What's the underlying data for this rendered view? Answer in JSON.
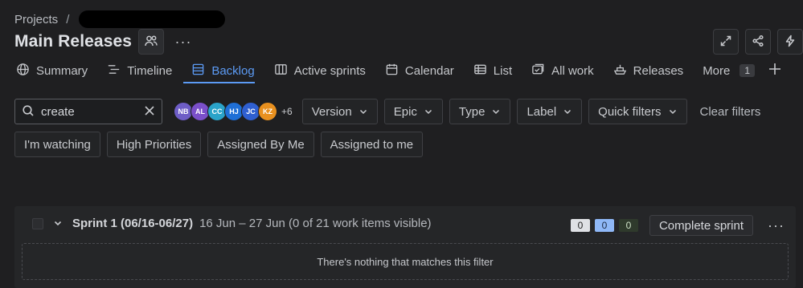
{
  "breadcrumb": {
    "root": "Projects",
    "separator": "/"
  },
  "header": {
    "title": "Main Releases",
    "more": "···"
  },
  "tabs": [
    {
      "label": "Summary",
      "icon": "globe-icon"
    },
    {
      "label": "Timeline",
      "icon": "timeline-icon"
    },
    {
      "label": "Backlog",
      "icon": "backlog-icon",
      "active": true
    },
    {
      "label": "Active sprints",
      "icon": "board-icon"
    },
    {
      "label": "Calendar",
      "icon": "calendar-icon"
    },
    {
      "label": "List",
      "icon": "list-icon"
    },
    {
      "label": "All work",
      "icon": "all-work-icon"
    },
    {
      "label": "Releases",
      "icon": "ship-icon"
    },
    {
      "label": "More",
      "badge": "1"
    }
  ],
  "filters": {
    "search_value": "create",
    "avatars": [
      {
        "initials": "NB",
        "color": "#6e5dc6"
      },
      {
        "initials": "AL",
        "color": "#7a4fc9"
      },
      {
        "initials": "CC",
        "color": "#2aa3c9"
      },
      {
        "initials": "HJ",
        "color": "#1f6fd6"
      },
      {
        "initials": "JC",
        "color": "#2f5fd0"
      },
      {
        "initials": "KZ",
        "color": "#e8901f"
      }
    ],
    "avatars_more": "+6",
    "dropdowns": [
      "Version",
      "Epic",
      "Type",
      "Label",
      "Quick filters"
    ],
    "clear": "Clear filters",
    "quick": [
      "I'm watching",
      "High Priorities",
      "Assigned By Me",
      "Assigned to me"
    ]
  },
  "sprint": {
    "name": "Sprint 1 (06/16-06/27)",
    "meta": "16 Jun – 27 Jun (0 of 21 work items visible)",
    "counts": {
      "todo": "0",
      "in_progress": "0",
      "done": "0"
    },
    "complete_label": "Complete sprint",
    "more": "···",
    "empty_message": "There's nothing that matches this filter"
  },
  "colors": {
    "accent": "#5c9bf5",
    "background": "#1f1f21"
  }
}
